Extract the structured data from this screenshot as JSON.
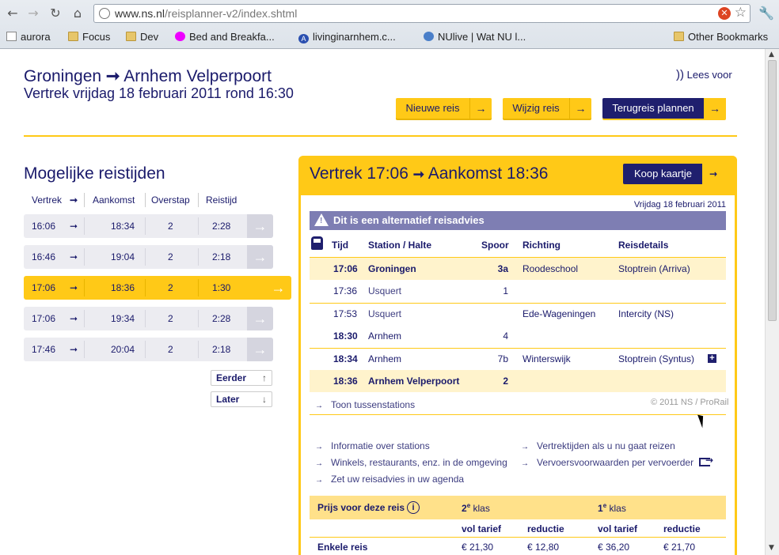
{
  "browser": {
    "url_domain": "www.ns.nl",
    "url_path": "/reisplanner-v2/index.shtml",
    "bookmarks": [
      {
        "label": "aurora",
        "icon": "page-icon"
      },
      {
        "label": "Focus",
        "icon": "folder-icon"
      },
      {
        "label": "Dev",
        "icon": "folder-icon"
      },
      {
        "label": "Bed and Breakfa...",
        "icon": "dot-icon"
      },
      {
        "label": "livinginarnhem.c...",
        "icon": "a-icon"
      },
      {
        "label": "NUlive | Wat NU l...",
        "icon": "nu-icon"
      },
      {
        "label": "Other Bookmarks",
        "icon": "folder-icon"
      }
    ]
  },
  "header": {
    "route_from": "Groningen",
    "route_to": "Arnhem Velperpoort",
    "departure": "Vertrek vrijdag 18 februari 2011 rond 16:30",
    "lees_voor": "Lees voor",
    "btn_nieuwe": "Nieuwe reis",
    "btn_wijzig": "Wijzig reis",
    "btn_terug": "Terugreis plannen"
  },
  "times": {
    "title": "Mogelijke reistijden",
    "headers": {
      "vertrek": "Vertrek",
      "aankomst": "Aankomst",
      "overstap": "Overstap",
      "reistijd": "Reistijd"
    },
    "rows": [
      {
        "dep": "16:06",
        "arr": "18:34",
        "transfers": "2",
        "duration": "2:28"
      },
      {
        "dep": "16:46",
        "arr": "19:04",
        "transfers": "2",
        "duration": "2:18"
      },
      {
        "dep": "17:06",
        "arr": "18:36",
        "transfers": "2",
        "duration": "1:30"
      },
      {
        "dep": "17:06",
        "arr": "19:34",
        "transfers": "2",
        "duration": "2:28"
      },
      {
        "dep": "17:46",
        "arr": "20:04",
        "transfers": "2",
        "duration": "2:18"
      }
    ],
    "earlier": "Eerder",
    "later": "Later"
  },
  "detail": {
    "dep_label": "Vertrek 17:06",
    "arr_label": "Aankomst 18:36",
    "koop": "Koop kaartje",
    "date": "Vrijdag 18 februari 2011",
    "alert": "Dit is een alternatief reisadvies",
    "cols": {
      "tijd": "Tijd",
      "station": "Station / Halte",
      "spoor": "Spoor",
      "richting": "Richting",
      "details": "Reisdetails"
    },
    "legs": [
      {
        "time": "17:06",
        "station": "Groningen",
        "track": "3a",
        "direction": "Roodeschool",
        "details": "Stoptrein (Arriva)"
      },
      {
        "time": "17:36",
        "station": "Usquert",
        "track": "1",
        "direction": "",
        "details": ""
      },
      {
        "time": "17:53",
        "station": "Usquert",
        "track": "",
        "direction": "Ede-Wageningen",
        "details": "Intercity (NS)"
      },
      {
        "time": "18:30",
        "station": "Arnhem",
        "track": "4",
        "direction": "",
        "details": ""
      },
      {
        "time": "18:34",
        "station": "Arnhem",
        "track": "7b",
        "direction": "Winterswijk",
        "details": "Stoptrein (Syntus)"
      },
      {
        "time": "18:36",
        "station": "Arnhem Velperpoort",
        "track": "2",
        "direction": "",
        "details": ""
      }
    ],
    "toon": "Toon tussenstations",
    "copyright": "© 2011 NS / ProRail",
    "links_left": [
      "Informatie over stations",
      "Winkels, restaurants, enz. in de omgeving",
      "Zet uw reisadvies in uw agenda"
    ],
    "links_right": [
      "Vertrektijden als u nu gaat reizen",
      "Vervoersvoorwaarden per vervoerder"
    ],
    "price": {
      "title": "Prijs voor deze reis",
      "klas2": "2",
      "klas1": "1",
      "sup": "e",
      "klas_word": "klas",
      "vol": "vol tarief",
      "reductie": "reductie",
      "row_label": "Enkele reis",
      "values": [
        "€ 21,30",
        "€ 12,80",
        "€ 36,20",
        "€ 21,70"
      ]
    }
  }
}
